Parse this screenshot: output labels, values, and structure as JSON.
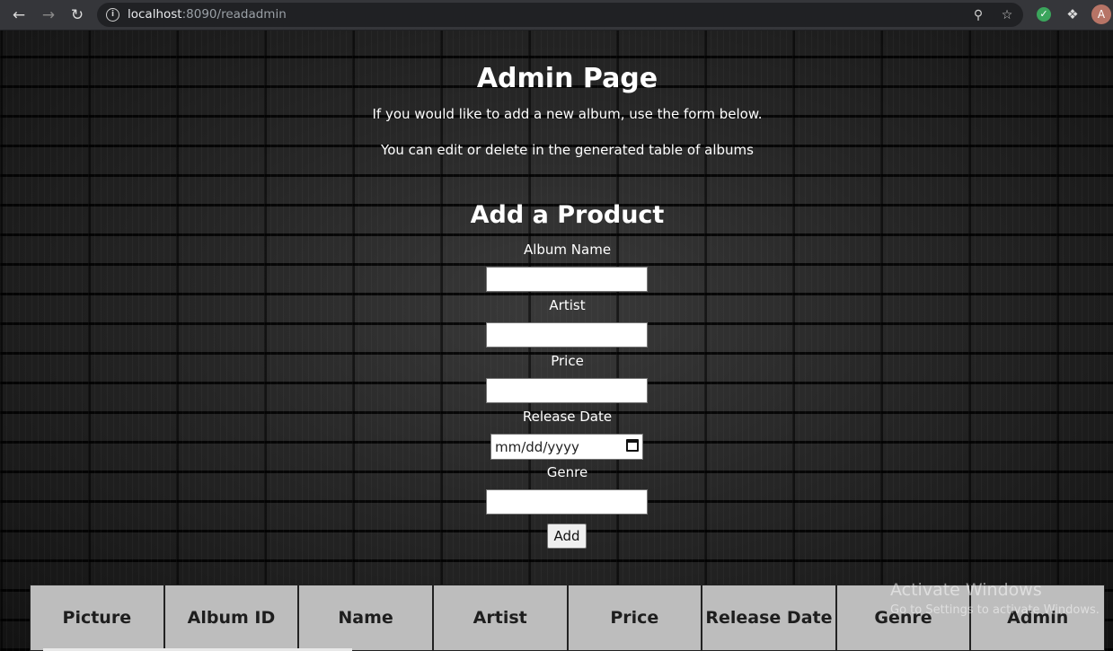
{
  "browser": {
    "url_host": "localhost",
    "url_rest": ":8090/readadmin",
    "avatar_letter": "A"
  },
  "page": {
    "title": "Admin Page",
    "intro_line1": "If you would like to add a new album, use the form below.",
    "intro_line2": "You can edit or delete in the generated table of albums"
  },
  "form": {
    "heading": "Add a Product",
    "album_name_label": "Album Name",
    "artist_label": "Artist",
    "price_label": "Price",
    "release_date_label": "Release Date",
    "release_date_placeholder": "mm/dd/yyyy",
    "genre_label": "Genre",
    "add_button": "Add"
  },
  "table": {
    "headers": [
      "Picture",
      "Album ID",
      "Name",
      "Artist",
      "Price",
      "Release Date",
      "Genre",
      "Admin"
    ]
  },
  "watermark": {
    "line1": "Activate Windows",
    "line2": "Go to Settings to activate Windows."
  }
}
